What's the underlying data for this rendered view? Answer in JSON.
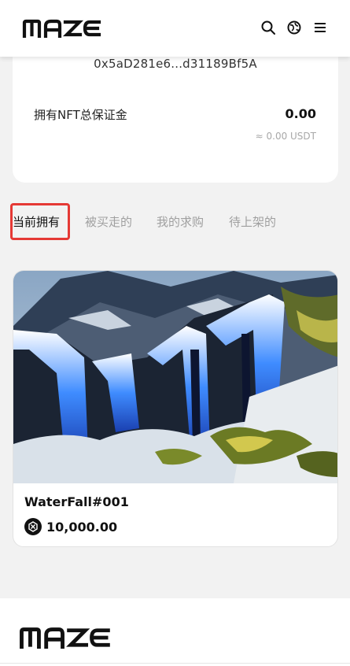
{
  "header": {
    "logo_text": "MAZE",
    "icons": [
      "search-icon",
      "language-icon",
      "menu-icon"
    ]
  },
  "wallet": {
    "address": "0x5aD281e6...d31189Bf5A",
    "deposit_label": "拥有NFT总保证金",
    "deposit_value": "0.00",
    "deposit_usdt": "≈ 0.00 USDT"
  },
  "tabs": [
    {
      "label": "当前拥有",
      "active": true
    },
    {
      "label": "被买走的",
      "active": false
    },
    {
      "label": "我的求购",
      "active": false
    },
    {
      "label": "待上架的",
      "active": false
    }
  ],
  "nft": {
    "name": "WaterFall#001",
    "price": "10,000.00",
    "price_icon": "token-icon"
  },
  "footer": {
    "logo_text": "MAZE"
  },
  "colors": {
    "highlight": "#e53935",
    "background": "#f2f2f2"
  }
}
